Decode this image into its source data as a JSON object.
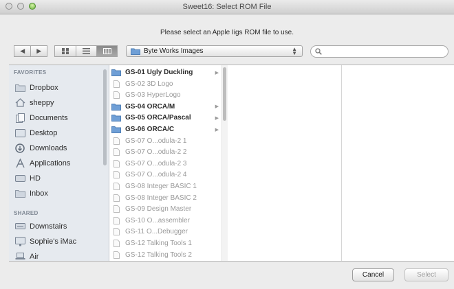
{
  "window": {
    "title": "Sweet16: Select ROM File"
  },
  "prompt": "Please select an Apple Iigs ROM file to use.",
  "toolbar": {
    "back_icon": "chevron-left-icon",
    "forward_icon": "chevron-right-icon",
    "view_modes": [
      "icon-view",
      "list-view",
      "column-view"
    ],
    "active_view": "column-view",
    "location": "Byte Works Images",
    "search_value": "",
    "search_placeholder": ""
  },
  "sidebar": {
    "favorites_header": "FAVORITES",
    "favorites": [
      {
        "label": "Dropbox",
        "icon": "folder-icon"
      },
      {
        "label": "sheppy",
        "icon": "home-icon"
      },
      {
        "label": "Documents",
        "icon": "documents-icon"
      },
      {
        "label": "Desktop",
        "icon": "desktop-icon"
      },
      {
        "label": "Downloads",
        "icon": "downloads-icon"
      },
      {
        "label": "Applications",
        "icon": "applications-icon"
      },
      {
        "label": "HD",
        "icon": "hard-drive-icon"
      },
      {
        "label": "Inbox",
        "icon": "folder-icon"
      }
    ],
    "shared_header": "SHARED",
    "shared": [
      {
        "label": "Downstairs",
        "icon": "network-server-icon"
      },
      {
        "label": "Sophie's iMac",
        "icon": "imac-icon"
      },
      {
        "label": "Air",
        "icon": "laptop-icon"
      }
    ]
  },
  "column1": [
    {
      "name": "GS-01 Ugly Duckling",
      "kind": "folder"
    },
    {
      "name": "GS-02 3D Logo",
      "kind": "file"
    },
    {
      "name": "GS-03 HyperLogo",
      "kind": "file"
    },
    {
      "name": "GS-04 ORCA/M",
      "kind": "folder"
    },
    {
      "name": "GS-05 ORCA/Pascal",
      "kind": "folder"
    },
    {
      "name": "GS-06 ORCA/C",
      "kind": "folder"
    },
    {
      "name": "GS-07 O...odula-2 1",
      "kind": "file"
    },
    {
      "name": "GS-07 O...odula-2 2",
      "kind": "file"
    },
    {
      "name": "GS-07 O...odula-2 3",
      "kind": "file"
    },
    {
      "name": "GS-07 O...odula-2 4",
      "kind": "file"
    },
    {
      "name": "GS-08 Integer BASIC 1",
      "kind": "file"
    },
    {
      "name": "GS-08 Integer BASIC 2",
      "kind": "file"
    },
    {
      "name": "GS-09 Design Master",
      "kind": "file"
    },
    {
      "name": "GS-10 O...assembler",
      "kind": "file"
    },
    {
      "name": "GS-11 O...Debugger",
      "kind": "file"
    },
    {
      "name": "GS-12 Talking Tools 1",
      "kind": "file"
    },
    {
      "name": "GS-12 Talking Tools 2",
      "kind": "file"
    }
  ],
  "buttons": {
    "cancel": "Cancel",
    "select": "Select"
  },
  "colors": {
    "folder": "#6f9fd6",
    "sidebar_bg": "#e6eaef",
    "window_bg": "#ececec"
  }
}
